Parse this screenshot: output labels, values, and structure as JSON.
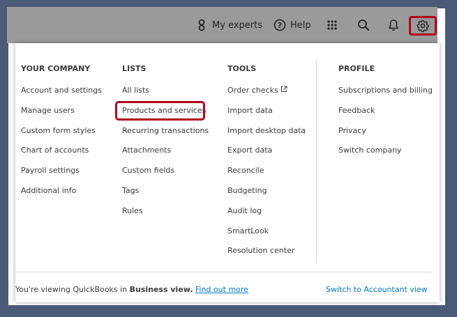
{
  "topbar": {
    "my_experts_label": "My experts",
    "help_label": "Help",
    "icons": [
      "experts-icon",
      "help-icon",
      "apps-grid-icon",
      "search-icon",
      "bell-icon",
      "gear-icon"
    ]
  },
  "columns": {
    "company": {
      "heading": "YOUR COMPANY",
      "items": [
        "Account and settings",
        "Manage users",
        "Custom form styles",
        "Chart of accounts",
        "Payroll settings",
        "Additional info"
      ]
    },
    "lists": {
      "heading": "LISTS",
      "items": [
        "All lists",
        "Products and services",
        "Recurring transactions",
        "Attachments",
        "Custom fields",
        "Tags",
        "Rules"
      ]
    },
    "tools": {
      "heading": "TOOLS",
      "items": [
        "Order checks",
        "Import data",
        "Import desktop data",
        "Export data",
        "Reconcile",
        "Budgeting",
        "Audit log",
        "SmartLook",
        "Resolution center"
      ]
    },
    "profile": {
      "heading": "PROFILE",
      "items": [
        "Subscriptions and billing",
        "Feedback",
        "Privacy",
        "Switch company"
      ]
    }
  },
  "footer": {
    "viewing_prefix": "You're viewing QuickBooks in",
    "view_name": "Business view.",
    "find_out_more": "Find out more",
    "switch_view": "Switch to Accountant view"
  },
  "colors": {
    "highlight": "#b3001b",
    "link": "#0077c5",
    "topbar": "#9a9a9a",
    "backdrop": "#4a5a77"
  }
}
